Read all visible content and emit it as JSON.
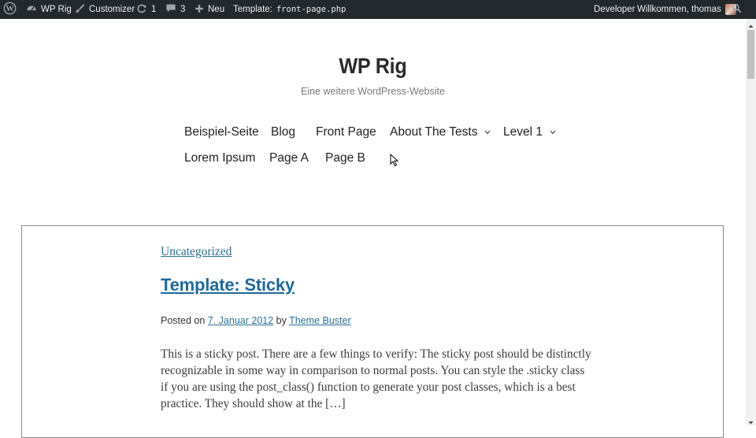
{
  "admin_bar": {
    "site_name": "WP Rig",
    "customizer": "Customizer",
    "updates_count": "1",
    "comments_count": "3",
    "new_label": "Neu",
    "template_prefix": "Template:",
    "template_file": "front-page.php",
    "developer": "Developer",
    "greeting": "Willkommen, thomas"
  },
  "site": {
    "title": "WP Rig",
    "tagline": "Eine weitere WordPress-Website"
  },
  "nav": {
    "items": [
      "Beispiel-Seite",
      "Blog",
      "Front Page",
      "About The Tests",
      "Level 1",
      "Lorem Ipsum",
      "Page A",
      "Page B"
    ]
  },
  "post": {
    "category": "Uncategorized",
    "title": "Template: Sticky",
    "meta_posted_on": "Posted on",
    "date": "7. Januar 2012",
    "meta_by": "by",
    "author": "Theme Buster",
    "excerpt": "This is a sticky post. There are a few things to verify: The sticky post should be distinctly recognizable in some way in comparison to normal posts. You can style the .sticky class if you are using the post_class() function to generate your post classes, which is a best practice. They should show at the […]"
  },
  "icons": {
    "wordpress": "wordpress-logo-icon",
    "site": "dashboard-icon",
    "customizer": "brush-icon",
    "updates": "refresh-icon",
    "comments": "comment-icon",
    "new": "plus-icon",
    "search": "search-icon"
  }
}
